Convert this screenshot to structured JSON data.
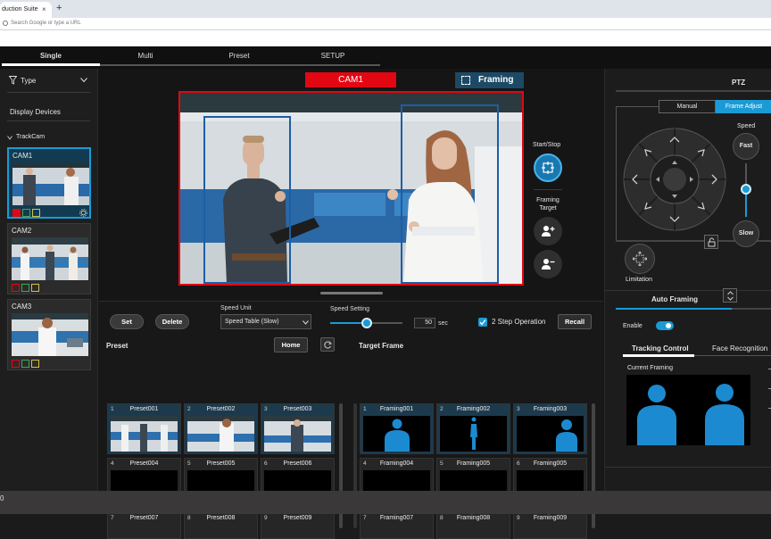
{
  "browser": {
    "tab_title": "duction Suite",
    "tab_close": "×",
    "new_tab": "+",
    "omnibox_placeholder": "Search Google or type a URL"
  },
  "main_tabs": [
    {
      "label": "Single",
      "active": true
    },
    {
      "label": "Multi",
      "active": false
    },
    {
      "label": "Preset",
      "active": false
    },
    {
      "label": "SETUP",
      "active": false
    }
  ],
  "sidebar": {
    "type_label": "Type",
    "display_devices_label": "Display Devices",
    "trackcam_label": "TrackCam",
    "cameras": [
      {
        "label": "CAM1",
        "selected": true
      },
      {
        "label": "CAM2",
        "selected": false
      },
      {
        "label": "CAM3",
        "selected": false
      }
    ]
  },
  "center": {
    "camera_title": "CAM1",
    "framing_label": "Framing",
    "start_stop_label": "Start/Stop",
    "framing_target_label": "Framing\nTarget"
  },
  "controls": {
    "set_label": "Set",
    "delete_label": "Delete",
    "speed_unit_label": "Speed Unit",
    "speed_unit_value": "Speed Table (Slow)",
    "speed_setting_label": "Speed Setting",
    "speed_setting_value": "50",
    "speed_setting_unit": "sec",
    "speed_setting_fraction": 0.5,
    "two_step_label": "2 Step Operation",
    "two_step_checked": true,
    "recall_label": "Recall"
  },
  "preset": {
    "title": "Preset",
    "home_label": "Home",
    "items": [
      {
        "num": "1",
        "name": "Preset001"
      },
      {
        "num": "2",
        "name": "Preset002"
      },
      {
        "num": "3",
        "name": "Preset003"
      },
      {
        "num": "4",
        "name": "Preset004"
      },
      {
        "num": "5",
        "name": "Preset005"
      },
      {
        "num": "6",
        "name": "Preset006"
      },
      {
        "num": "7",
        "name": "Preset007"
      },
      {
        "num": "8",
        "name": "Preset008"
      },
      {
        "num": "9",
        "name": "Preset009"
      }
    ]
  },
  "target_frame": {
    "title": "Target Frame",
    "items": [
      {
        "num": "1",
        "name": "Framing001"
      },
      {
        "num": "2",
        "name": "Framing002"
      },
      {
        "num": "3",
        "name": "Framing003"
      },
      {
        "num": "4",
        "name": "Framing004"
      },
      {
        "num": "5",
        "name": "Framing005"
      },
      {
        "num": "6",
        "name": "Framing005"
      },
      {
        "num": "7",
        "name": "Framing007"
      },
      {
        "num": "8",
        "name": "Framing008"
      },
      {
        "num": "9",
        "name": "Framing009"
      }
    ]
  },
  "ptz": {
    "title": "PTZ",
    "manual_label": "Manual",
    "frame_adjust_label": "Frame Adjust",
    "speed_label": "Speed",
    "fast_label": "Fast",
    "slow_label": "Slow",
    "limitation_label": "Limitation"
  },
  "auto_framing": {
    "title": "Auto Framing",
    "enable_label": "Enable",
    "enabled": true,
    "tracking_control_label": "Tracking Control",
    "face_recognition_label": "Face Recognition",
    "current_framing_label": "Current Framing"
  },
  "status_bar": {
    "text": "0"
  },
  "colors": {
    "accent": "#1a9bd6",
    "red": "#e30613",
    "figure_blue": "#1c8ad0"
  }
}
